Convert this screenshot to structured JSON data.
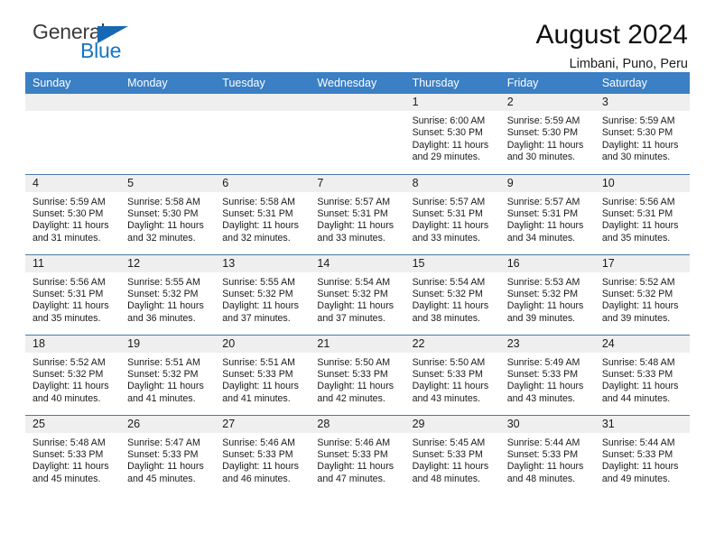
{
  "brand": {
    "name_part1": "General",
    "name_part2": "Blue",
    "triangle_color": "#1569b4",
    "text_color": "#3b3b3b",
    "blue_color": "#1476c6"
  },
  "header": {
    "title": "August 2024",
    "subtitle": "Limbani, Puno, Peru"
  },
  "colors": {
    "header_bg": "#3b7fc4",
    "daynum_bg": "#efefef",
    "row_divider": "#4a7ba7"
  },
  "weekday_headers": [
    "Sunday",
    "Monday",
    "Tuesday",
    "Wednesday",
    "Thursday",
    "Friday",
    "Saturday"
  ],
  "labels": {
    "sunrise_prefix": "Sunrise:",
    "sunset_prefix": "Sunset:",
    "daylight_prefix": "Daylight:"
  },
  "weeks": [
    [
      {
        "empty": true
      },
      {
        "empty": true
      },
      {
        "empty": true
      },
      {
        "empty": true
      },
      {
        "day": "1",
        "sunrise": "Sunrise: 6:00 AM",
        "sunset": "Sunset: 5:30 PM",
        "daylight1": "Daylight: 11 hours",
        "daylight2": "and 29 minutes."
      },
      {
        "day": "2",
        "sunrise": "Sunrise: 5:59 AM",
        "sunset": "Sunset: 5:30 PM",
        "daylight1": "Daylight: 11 hours",
        "daylight2": "and 30 minutes."
      },
      {
        "day": "3",
        "sunrise": "Sunrise: 5:59 AM",
        "sunset": "Sunset: 5:30 PM",
        "daylight1": "Daylight: 11 hours",
        "daylight2": "and 30 minutes."
      }
    ],
    [
      {
        "day": "4",
        "sunrise": "Sunrise: 5:59 AM",
        "sunset": "Sunset: 5:30 PM",
        "daylight1": "Daylight: 11 hours",
        "daylight2": "and 31 minutes."
      },
      {
        "day": "5",
        "sunrise": "Sunrise: 5:58 AM",
        "sunset": "Sunset: 5:30 PM",
        "daylight1": "Daylight: 11 hours",
        "daylight2": "and 32 minutes."
      },
      {
        "day": "6",
        "sunrise": "Sunrise: 5:58 AM",
        "sunset": "Sunset: 5:31 PM",
        "daylight1": "Daylight: 11 hours",
        "daylight2": "and 32 minutes."
      },
      {
        "day": "7",
        "sunrise": "Sunrise: 5:57 AM",
        "sunset": "Sunset: 5:31 PM",
        "daylight1": "Daylight: 11 hours",
        "daylight2": "and 33 minutes."
      },
      {
        "day": "8",
        "sunrise": "Sunrise: 5:57 AM",
        "sunset": "Sunset: 5:31 PM",
        "daylight1": "Daylight: 11 hours",
        "daylight2": "and 33 minutes."
      },
      {
        "day": "9",
        "sunrise": "Sunrise: 5:57 AM",
        "sunset": "Sunset: 5:31 PM",
        "daylight1": "Daylight: 11 hours",
        "daylight2": "and 34 minutes."
      },
      {
        "day": "10",
        "sunrise": "Sunrise: 5:56 AM",
        "sunset": "Sunset: 5:31 PM",
        "daylight1": "Daylight: 11 hours",
        "daylight2": "and 35 minutes."
      }
    ],
    [
      {
        "day": "11",
        "sunrise": "Sunrise: 5:56 AM",
        "sunset": "Sunset: 5:31 PM",
        "daylight1": "Daylight: 11 hours",
        "daylight2": "and 35 minutes."
      },
      {
        "day": "12",
        "sunrise": "Sunrise: 5:55 AM",
        "sunset": "Sunset: 5:32 PM",
        "daylight1": "Daylight: 11 hours",
        "daylight2": "and 36 minutes."
      },
      {
        "day": "13",
        "sunrise": "Sunrise: 5:55 AM",
        "sunset": "Sunset: 5:32 PM",
        "daylight1": "Daylight: 11 hours",
        "daylight2": "and 37 minutes."
      },
      {
        "day": "14",
        "sunrise": "Sunrise: 5:54 AM",
        "sunset": "Sunset: 5:32 PM",
        "daylight1": "Daylight: 11 hours",
        "daylight2": "and 37 minutes."
      },
      {
        "day": "15",
        "sunrise": "Sunrise: 5:54 AM",
        "sunset": "Sunset: 5:32 PM",
        "daylight1": "Daylight: 11 hours",
        "daylight2": "and 38 minutes."
      },
      {
        "day": "16",
        "sunrise": "Sunrise: 5:53 AM",
        "sunset": "Sunset: 5:32 PM",
        "daylight1": "Daylight: 11 hours",
        "daylight2": "and 39 minutes."
      },
      {
        "day": "17",
        "sunrise": "Sunrise: 5:52 AM",
        "sunset": "Sunset: 5:32 PM",
        "daylight1": "Daylight: 11 hours",
        "daylight2": "and 39 minutes."
      }
    ],
    [
      {
        "day": "18",
        "sunrise": "Sunrise: 5:52 AM",
        "sunset": "Sunset: 5:32 PM",
        "daylight1": "Daylight: 11 hours",
        "daylight2": "and 40 minutes."
      },
      {
        "day": "19",
        "sunrise": "Sunrise: 5:51 AM",
        "sunset": "Sunset: 5:32 PM",
        "daylight1": "Daylight: 11 hours",
        "daylight2": "and 41 minutes."
      },
      {
        "day": "20",
        "sunrise": "Sunrise: 5:51 AM",
        "sunset": "Sunset: 5:33 PM",
        "daylight1": "Daylight: 11 hours",
        "daylight2": "and 41 minutes."
      },
      {
        "day": "21",
        "sunrise": "Sunrise: 5:50 AM",
        "sunset": "Sunset: 5:33 PM",
        "daylight1": "Daylight: 11 hours",
        "daylight2": "and 42 minutes."
      },
      {
        "day": "22",
        "sunrise": "Sunrise: 5:50 AM",
        "sunset": "Sunset: 5:33 PM",
        "daylight1": "Daylight: 11 hours",
        "daylight2": "and 43 minutes."
      },
      {
        "day": "23",
        "sunrise": "Sunrise: 5:49 AM",
        "sunset": "Sunset: 5:33 PM",
        "daylight1": "Daylight: 11 hours",
        "daylight2": "and 43 minutes."
      },
      {
        "day": "24",
        "sunrise": "Sunrise: 5:48 AM",
        "sunset": "Sunset: 5:33 PM",
        "daylight1": "Daylight: 11 hours",
        "daylight2": "and 44 minutes."
      }
    ],
    [
      {
        "day": "25",
        "sunrise": "Sunrise: 5:48 AM",
        "sunset": "Sunset: 5:33 PM",
        "daylight1": "Daylight: 11 hours",
        "daylight2": "and 45 minutes."
      },
      {
        "day": "26",
        "sunrise": "Sunrise: 5:47 AM",
        "sunset": "Sunset: 5:33 PM",
        "daylight1": "Daylight: 11 hours",
        "daylight2": "and 45 minutes."
      },
      {
        "day": "27",
        "sunrise": "Sunrise: 5:46 AM",
        "sunset": "Sunset: 5:33 PM",
        "daylight1": "Daylight: 11 hours",
        "daylight2": "and 46 minutes."
      },
      {
        "day": "28",
        "sunrise": "Sunrise: 5:46 AM",
        "sunset": "Sunset: 5:33 PM",
        "daylight1": "Daylight: 11 hours",
        "daylight2": "and 47 minutes."
      },
      {
        "day": "29",
        "sunrise": "Sunrise: 5:45 AM",
        "sunset": "Sunset: 5:33 PM",
        "daylight1": "Daylight: 11 hours",
        "daylight2": "and 48 minutes."
      },
      {
        "day": "30",
        "sunrise": "Sunrise: 5:44 AM",
        "sunset": "Sunset: 5:33 PM",
        "daylight1": "Daylight: 11 hours",
        "daylight2": "and 48 minutes."
      },
      {
        "day": "31",
        "sunrise": "Sunrise: 5:44 AM",
        "sunset": "Sunset: 5:33 PM",
        "daylight1": "Daylight: 11 hours",
        "daylight2": "and 49 minutes."
      }
    ]
  ]
}
